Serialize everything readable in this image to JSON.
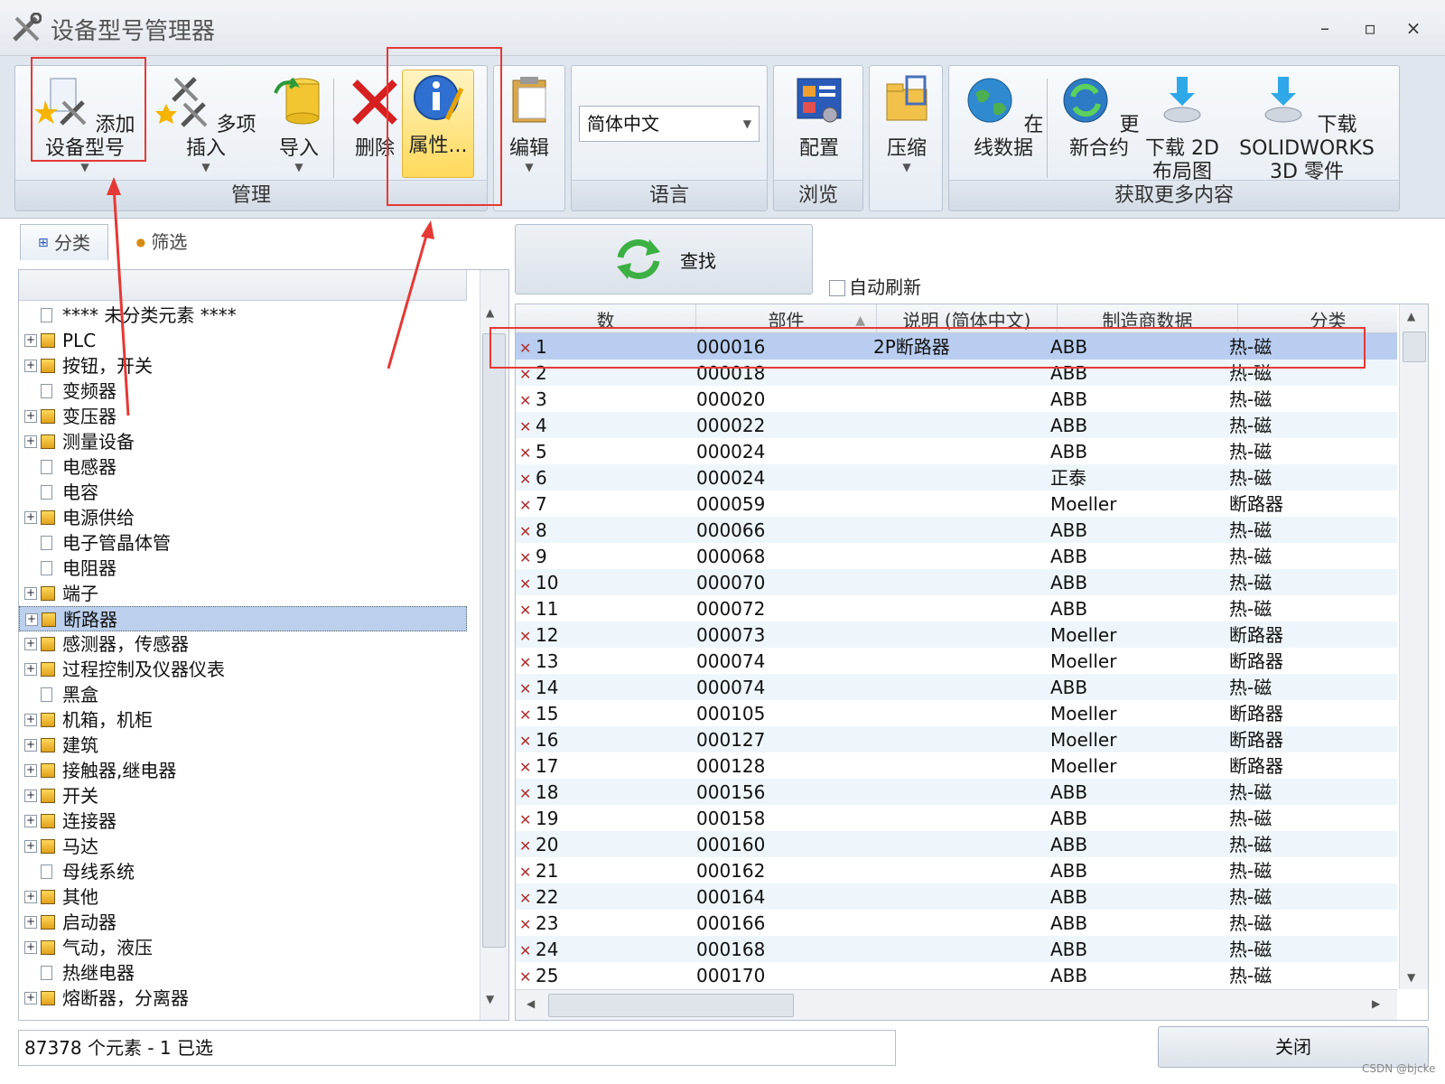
{
  "window": {
    "title": "设备型号管理器",
    "min": "–",
    "max": "▫",
    "close": "×"
  },
  "ribbon": {
    "add_device": "添加设备型号",
    "multi_insert": "多项插入",
    "import": "导入",
    "delete": "删除",
    "properties": "属性...",
    "group_manage": "管理",
    "edit": "编辑",
    "language_value": "简体中文",
    "group_language": "语言",
    "config": "配置",
    "group_browse": "浏览",
    "compress": "压缩",
    "online_data": "在线数据",
    "update_contract": "更新合约",
    "download_2d_l1": "下载 2D",
    "download_2d_l2": "布局图",
    "download_sw_l1": "下载 SOLIDWORKS",
    "download_sw_l2": "3D 零件",
    "group_more": "获取更多内容"
  },
  "tabs": {
    "category": "分类",
    "filter": "筛选"
  },
  "tree": [
    {
      "label": "**** 未分类元素 ****",
      "expandable": false
    },
    {
      "label": "PLC",
      "expandable": true
    },
    {
      "label": "按钮，开关",
      "expandable": true
    },
    {
      "label": "变频器",
      "expandable": false
    },
    {
      "label": "变压器",
      "expandable": true
    },
    {
      "label": "测量设备",
      "expandable": true
    },
    {
      "label": "电感器",
      "expandable": false
    },
    {
      "label": "电容",
      "expandable": false
    },
    {
      "label": "电源供给",
      "expandable": true
    },
    {
      "label": "电子管晶体管",
      "expandable": false
    },
    {
      "label": "电阻器",
      "expandable": false
    },
    {
      "label": "端子",
      "expandable": true
    },
    {
      "label": "断路器",
      "expandable": true,
      "selected": true
    },
    {
      "label": "感测器，传感器",
      "expandable": true
    },
    {
      "label": "过程控制及仪器仪表",
      "expandable": true
    },
    {
      "label": "黑盒",
      "expandable": false
    },
    {
      "label": "机箱，机柜",
      "expandable": true
    },
    {
      "label": "建筑",
      "expandable": true
    },
    {
      "label": "接触器,继电器",
      "expandable": true
    },
    {
      "label": "开关",
      "expandable": true
    },
    {
      "label": "连接器",
      "expandable": true
    },
    {
      "label": "马达",
      "expandable": true
    },
    {
      "label": "母线系统",
      "expandable": false
    },
    {
      "label": "其他",
      "expandable": true
    },
    {
      "label": "启动器",
      "expandable": true
    },
    {
      "label": "气动，液压",
      "expandable": true
    },
    {
      "label": "热继电器",
      "expandable": false
    },
    {
      "label": "熔断器，分离器",
      "expandable": true
    }
  ],
  "search": {
    "label": "查找",
    "auto_refresh": "自动刷新"
  },
  "grid": {
    "columns": [
      "数",
      "部件",
      "说明 (简体中文)",
      "制造商数据",
      "分类"
    ],
    "rows": [
      [
        "1",
        "000016",
        "2P断路器",
        "ABB",
        "热-磁"
      ],
      [
        "2",
        "000018",
        "",
        "ABB",
        "热-磁"
      ],
      [
        "3",
        "000020",
        "",
        "ABB",
        "热-磁"
      ],
      [
        "4",
        "000022",
        "",
        "ABB",
        "热-磁"
      ],
      [
        "5",
        "000024",
        "",
        "ABB",
        "热-磁"
      ],
      [
        "6",
        "000024",
        "",
        "正泰",
        "热-磁"
      ],
      [
        "7",
        "000059",
        "",
        "Moeller",
        "断路器"
      ],
      [
        "8",
        "000066",
        "",
        "ABB",
        "热-磁"
      ],
      [
        "9",
        "000068",
        "",
        "ABB",
        "热-磁"
      ],
      [
        "10",
        "000070",
        "",
        "ABB",
        "热-磁"
      ],
      [
        "11",
        "000072",
        "",
        "ABB",
        "热-磁"
      ],
      [
        "12",
        "000073",
        "",
        "Moeller",
        "断路器"
      ],
      [
        "13",
        "000074",
        "",
        "Moeller",
        "断路器"
      ],
      [
        "14",
        "000074",
        "",
        "ABB",
        "热-磁"
      ],
      [
        "15",
        "000105",
        "",
        "Moeller",
        "断路器"
      ],
      [
        "16",
        "000127",
        "",
        "Moeller",
        "断路器"
      ],
      [
        "17",
        "000128",
        "",
        "Moeller",
        "断路器"
      ],
      [
        "18",
        "000156",
        "",
        "ABB",
        "热-磁"
      ],
      [
        "19",
        "000158",
        "",
        "ABB",
        "热-磁"
      ],
      [
        "20",
        "000160",
        "",
        "ABB",
        "热-磁"
      ],
      [
        "21",
        "000162",
        "",
        "ABB",
        "热-磁"
      ],
      [
        "22",
        "000164",
        "",
        "ABB",
        "热-磁"
      ],
      [
        "23",
        "000166",
        "",
        "ABB",
        "热-磁"
      ],
      [
        "24",
        "000168",
        "",
        "ABB",
        "热-磁"
      ],
      [
        "25",
        "000170",
        "",
        "ABB",
        "热-磁"
      ]
    ]
  },
  "status": {
    "text": "87378 个元素 - 1 已选"
  },
  "close_button": "关闭",
  "watermark": "CSDN @bjcke"
}
